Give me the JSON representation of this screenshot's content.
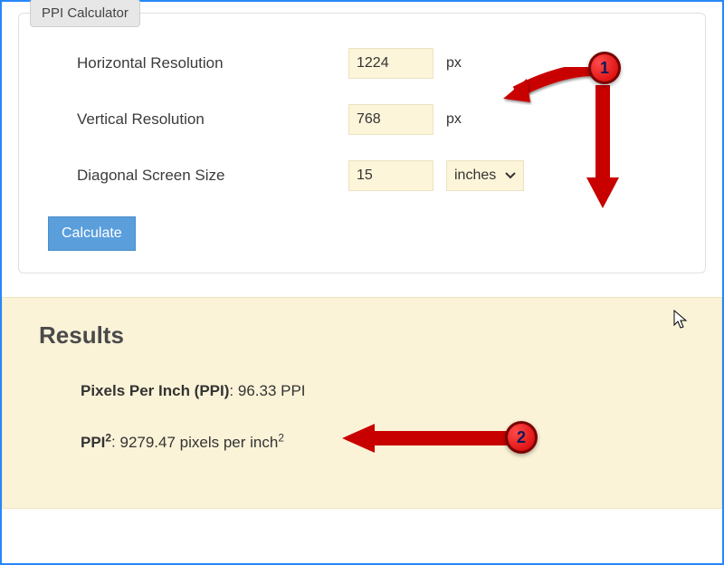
{
  "calculator": {
    "legend": "PPI Calculator",
    "fields": {
      "horizontal": {
        "label": "Horizontal Resolution",
        "value": "1224",
        "unit": "px"
      },
      "vertical": {
        "label": "Vertical Resolution",
        "value": "768",
        "unit": "px"
      },
      "diagonal": {
        "label": "Diagonal Screen Size",
        "value": "15",
        "unit_selected": "inches"
      }
    },
    "calculate_label": "Calculate"
  },
  "results": {
    "title": "Results",
    "ppi": {
      "label_prefix": "Pixels Per Inch (PPI)",
      "value": "96.33 PPI"
    },
    "ppi2": {
      "label_prefix": "PPI",
      "label_suffix": "",
      "value": "9279.47 pixels per inch"
    }
  },
  "markers": {
    "m1": "1",
    "m2": "2"
  }
}
